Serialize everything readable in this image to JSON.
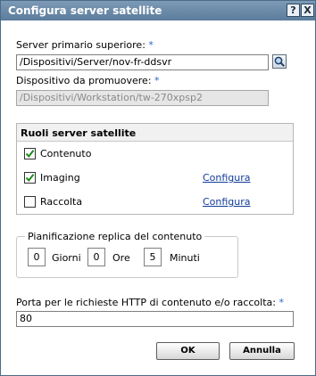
{
  "dialog": {
    "title": "Configura server satellite",
    "help_glyph": "?",
    "close_glyph": "X"
  },
  "primary_server": {
    "label": "Server primario superiore:",
    "required_mark": "*",
    "value": "/Dispositivi/Server/nov-fr-ddsvr",
    "browse_icon": "search-icon"
  },
  "device_to_promote": {
    "label": "Dispositivo da promuovere:",
    "required_mark": "*",
    "value": "/Dispositivi/Workstation/tw-270xpsp2"
  },
  "roles": {
    "header": "Ruoli server satellite",
    "items": [
      {
        "label": "Contenuto",
        "checked": true,
        "link": ""
      },
      {
        "label": "Imaging",
        "checked": true,
        "link": "Configura"
      },
      {
        "label": "Raccolta",
        "checked": false,
        "link": "Configura"
      }
    ]
  },
  "schedule": {
    "legend": "Pianificazione replica del contenuto",
    "days_value": "0",
    "days_label": "Giorni",
    "hours_value": "0",
    "hours_label": "Ore",
    "minutes_value": "5",
    "minutes_label": "Minuti"
  },
  "http_port": {
    "label": "Porta per le richieste HTTP di contenuto e/o raccolta:",
    "required_mark": "*",
    "value": "80"
  },
  "buttons": {
    "ok": "OK",
    "cancel": "Annulla"
  },
  "colors": {
    "title_bar": "#5b7c9c",
    "required": "#2b63c9",
    "link": "#123c9a"
  }
}
